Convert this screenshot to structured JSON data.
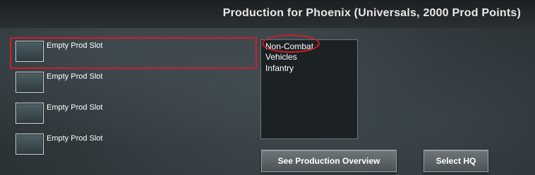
{
  "header": {
    "title": "Production for Phoenix (Universals, 2000 Prod Points)"
  },
  "slots": [
    {
      "label": "Empty Prod Slot"
    },
    {
      "label": "Empty Prod Slot"
    },
    {
      "label": "Empty Prod Slot"
    },
    {
      "label": "Empty Prod Slot"
    }
  ],
  "categories": [
    {
      "label": "Non-Combat"
    },
    {
      "label": "Vehicles"
    },
    {
      "label": "Infantry"
    }
  ],
  "buttons": {
    "overview_label": "See Production Overview",
    "hq_label": "Select HQ"
  },
  "colors": {
    "highlight": "#cc1f2a"
  }
}
